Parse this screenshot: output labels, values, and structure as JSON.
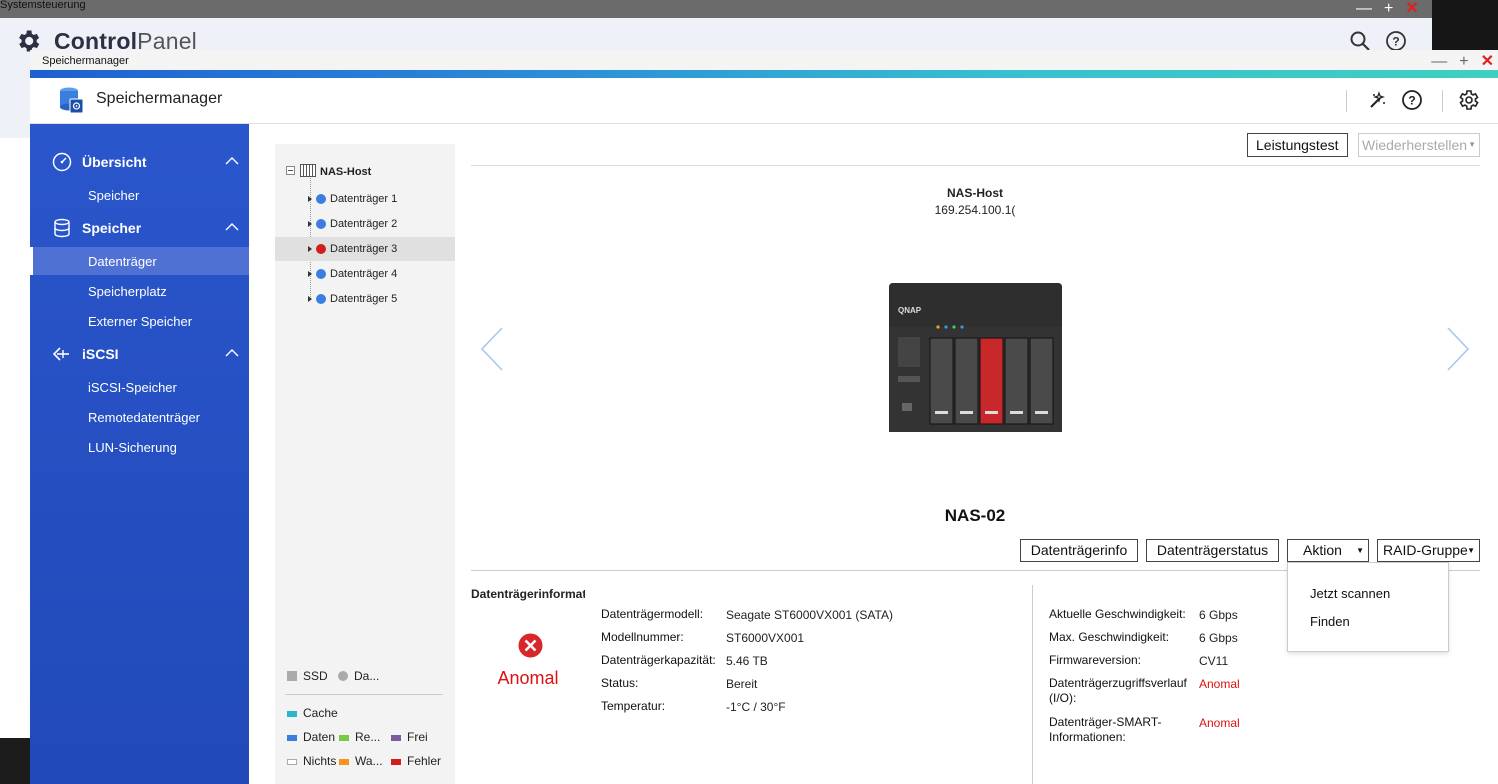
{
  "background": {
    "strip_title": "Systemsteuerung",
    "cp_title_bold": "Control",
    "cp_title_light": "Panel"
  },
  "window": {
    "titlebar": "Speichermanager",
    "app_title": "Speichermanager"
  },
  "sidebar": {
    "sections": [
      {
        "label": "Übersicht",
        "icon": "dashboard-icon",
        "items": [
          "Speicher"
        ]
      },
      {
        "label": "Speicher",
        "icon": "database-icon",
        "items": [
          "Datenträger",
          "Speicherplatz",
          "Externer Speicher"
        ]
      },
      {
        "label": "iSCSI",
        "icon": "iscsi-icon",
        "items": [
          "iSCSI-Speicher",
          "Remotedatenträger",
          "LUN-Sicherung"
        ]
      }
    ],
    "active_item": "Datenträger"
  },
  "tree": {
    "host": "NAS-Host",
    "disks": [
      {
        "label": "Datenträger 1",
        "status_color": "#3a7ee0"
      },
      {
        "label": "Datenträger 2",
        "status_color": "#3a7ee0"
      },
      {
        "label": "Datenträger 3",
        "status_color": "#d11d1d"
      },
      {
        "label": "Datenträger 4",
        "status_color": "#3a7ee0"
      },
      {
        "label": "Datenträger 5",
        "status_color": "#3a7ee0"
      }
    ]
  },
  "legend": {
    "ssd": "SSD",
    "da": "Da...",
    "cache": "Cache",
    "daten": "Daten",
    "re": "Re...",
    "frei": "Frei",
    "nichts": "Nichts",
    "wa": "Wa...",
    "fehler": "Fehler",
    "colors": {
      "cache": "#29b6c8",
      "daten": "#3a7ee0",
      "re": "#7ac943",
      "frei": "#7a5d9a",
      "nichts": "#ffffff",
      "wa": "#f7941d",
      "fehler": "#d11d1d"
    }
  },
  "toolbar": {
    "benchmark": "Leistungstest",
    "restore": "Wiederherstellen"
  },
  "host_panel": {
    "name": "NAS-Host",
    "ip": "169.254.100.1(",
    "model": "NAS-02"
  },
  "disk_toolbar": {
    "info": "Datenträgerinfo",
    "status": "Datenträgerstatus",
    "action": "Aktion",
    "raid": "RAID-Gruppe"
  },
  "action_menu": [
    "Jetzt scannen",
    "Finden"
  ],
  "disk_info": {
    "title": "Datenträgerinformati",
    "status_label": "Anomal",
    "left": [
      {
        "key": "Datenträgermodell:",
        "value": "Seagate ST6000VX001 (SATA)"
      },
      {
        "key": "Modellnummer:",
        "value": "ST6000VX001"
      },
      {
        "key": "Datenträgerkapazität:",
        "value": "5.46 TB"
      },
      {
        "key": "Status:",
        "value": "Bereit"
      },
      {
        "key": "Temperatur:",
        "value": "-1°C / 30°F"
      }
    ],
    "right": [
      {
        "key": "Aktuelle Geschwindigkeit:",
        "value": "6 Gbps"
      },
      {
        "key": "Max. Geschwindigkeit:",
        "value": "6 Gbps"
      },
      {
        "key": "Firmwareversion:",
        "value": "CV11"
      },
      {
        "key": "Datenträgerzugriffsverlauf (I/O):",
        "value": "Anomal"
      },
      {
        "key": "Datenträger-SMART-Informationen:",
        "value": "Anomal"
      }
    ]
  }
}
